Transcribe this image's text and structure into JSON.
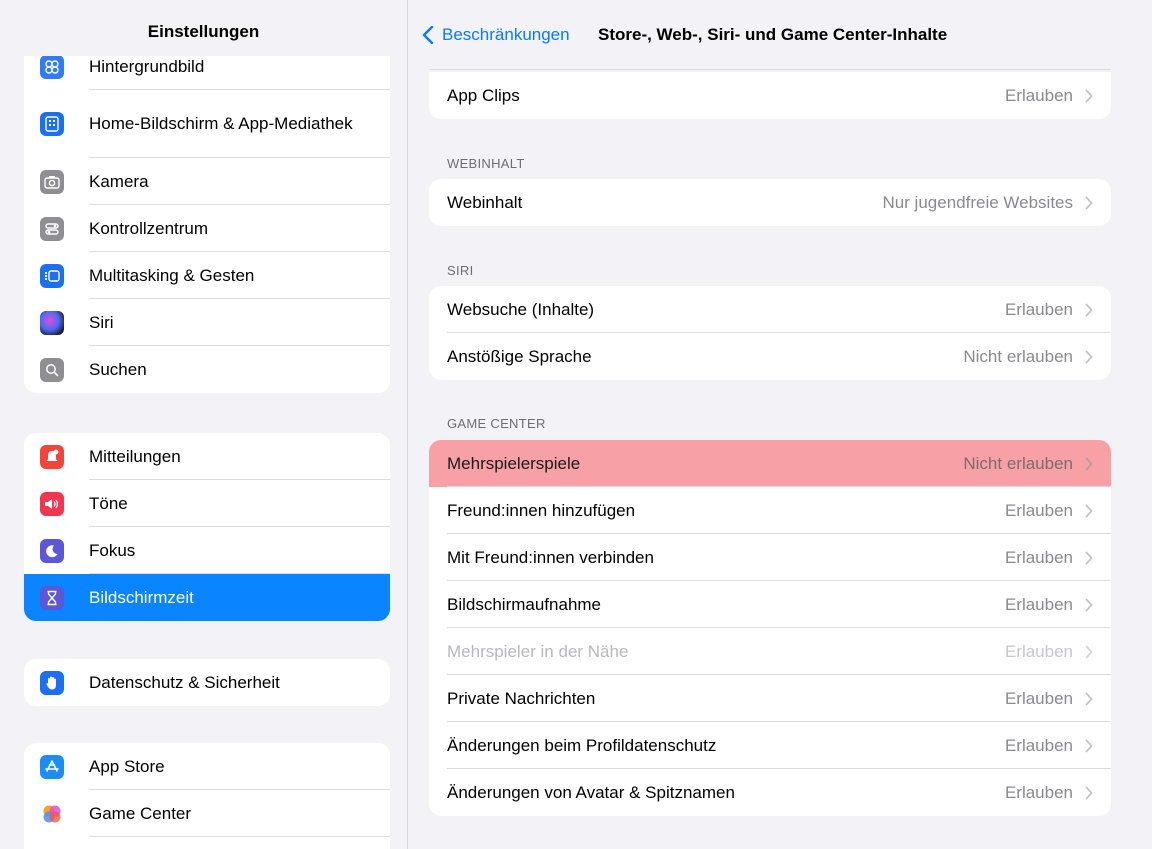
{
  "sidebar": {
    "title": "Einstellungen",
    "group1": [
      {
        "label": "Hintergrundbild",
        "icon": "wallpaper-icon",
        "color": "#2f7df6"
      },
      {
        "label": "Home-Bildschirm & App-Mediathek",
        "icon": "home-screen-icon",
        "color": "#1d6ff2"
      },
      {
        "label": "Kamera",
        "icon": "camera-icon",
        "color": "#8e8e93"
      },
      {
        "label": "Kontrollzentrum",
        "icon": "control-center-icon",
        "color": "#8e8e93"
      },
      {
        "label": "Multitasking & Gesten",
        "icon": "multitasking-icon",
        "color": "#1d6ff2"
      },
      {
        "label": "Siri",
        "icon": "siri-icon",
        "color": "#1c1c3a"
      },
      {
        "label": "Suchen",
        "icon": "search-icon",
        "color": "#8e8e93"
      }
    ],
    "group2": [
      {
        "label": "Mitteilungen",
        "icon": "notifications-icon",
        "color": "#f2443a"
      },
      {
        "label": "Töne",
        "icon": "sounds-icon",
        "color": "#f2364f"
      },
      {
        "label": "Fokus",
        "icon": "focus-moon-icon",
        "color": "#5b57d6"
      },
      {
        "label": "Bildschirmzeit",
        "icon": "screen-time-hourglass-icon",
        "color": "#5b57d6",
        "selected": true
      }
    ],
    "group3": [
      {
        "label": "Datenschutz & Sicherheit",
        "icon": "privacy-hand-icon",
        "color": "#1d6ff2"
      }
    ],
    "group4": [
      {
        "label": "App Store",
        "icon": "app-store-icon",
        "color": "#1c8df5"
      },
      {
        "label": "Game Center",
        "icon": "game-center-icon",
        "color": "#ffffff"
      }
    ]
  },
  "nav": {
    "back_label": "Beschränkungen",
    "title": "Store-, Web-, Siri- und Game Center-Inhalte"
  },
  "sections": {
    "app_clips": {
      "label": "App Clips",
      "value": "Erlauben"
    },
    "webinhalt": {
      "header": "WEBINHALT",
      "row": {
        "label": "Webinhalt",
        "value": "Nur jugendfreie Websites"
      }
    },
    "siri": {
      "header": "SIRI",
      "rows": [
        {
          "label": "Websuche (Inhalte)",
          "value": "Erlauben"
        },
        {
          "label": "Anstößige Sprache",
          "value": "Nicht erlauben"
        }
      ]
    },
    "game_center": {
      "header": "GAME CENTER",
      "rows": [
        {
          "label": "Mehrspielerspiele",
          "value": "Nicht erlauben",
          "highlighted": true
        },
        {
          "label": "Freund:innen hinzufügen",
          "value": "Erlauben"
        },
        {
          "label": "Mit Freund:innen verbinden",
          "value": "Erlauben"
        },
        {
          "label": "Bildschirmaufnahme",
          "value": "Erlauben"
        },
        {
          "label": "Mehrspieler in der Nähe",
          "value": "Erlauben",
          "disabled": true
        },
        {
          "label": "Private Nachrichten",
          "value": "Erlauben"
        },
        {
          "label": "Änderungen beim Profildatenschutz",
          "value": "Erlauben"
        },
        {
          "label": "Änderungen von Avatar & Spitznamen",
          "value": "Erlauben"
        }
      ]
    }
  },
  "colors": {
    "accent": "#0a7aff",
    "selection": "#0a84ff",
    "highlight": "#f7a1a7",
    "background": "#f2f2f7"
  }
}
